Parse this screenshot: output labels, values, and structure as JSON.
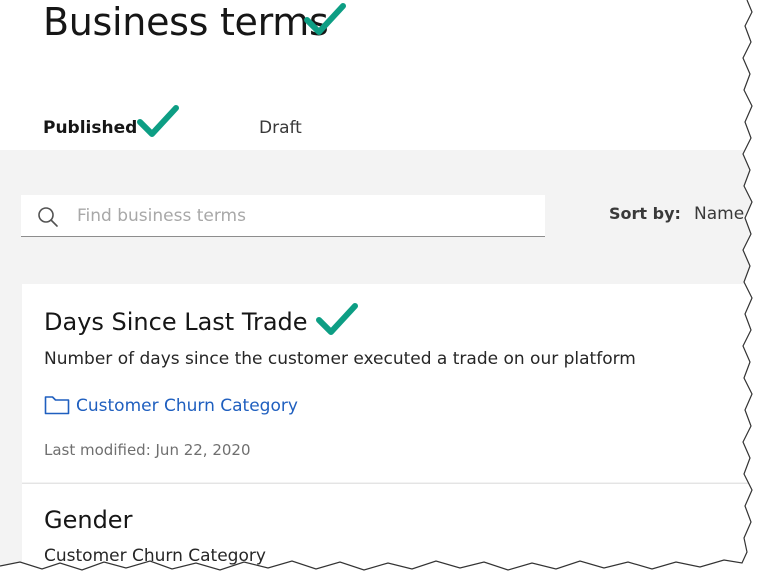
{
  "page_title": "Business terms",
  "tabs": [
    {
      "label": "Published",
      "selected": true
    },
    {
      "label": "Draft",
      "selected": false
    }
  ],
  "search": {
    "placeholder": "Find business terms",
    "value": ""
  },
  "sort": {
    "label": "Sort by:",
    "value": "Name"
  },
  "terms": [
    {
      "title": "Days Since Last Trade",
      "description": "Number of days since the customer executed a trade on our platform",
      "category": "Customer Churn Category",
      "modified": "Last modified: Jun 22, 2020"
    },
    {
      "title": "Gender",
      "description": "Customer Churn Category"
    }
  ],
  "icons": {
    "search": "search-icon",
    "folder": "folder-icon",
    "checkmark": "checkmark-icon"
  },
  "colors": {
    "accent_blue": "#1f5fbf",
    "checkmark_teal": "#0d9e84",
    "content_background": "#f3f3f3"
  }
}
